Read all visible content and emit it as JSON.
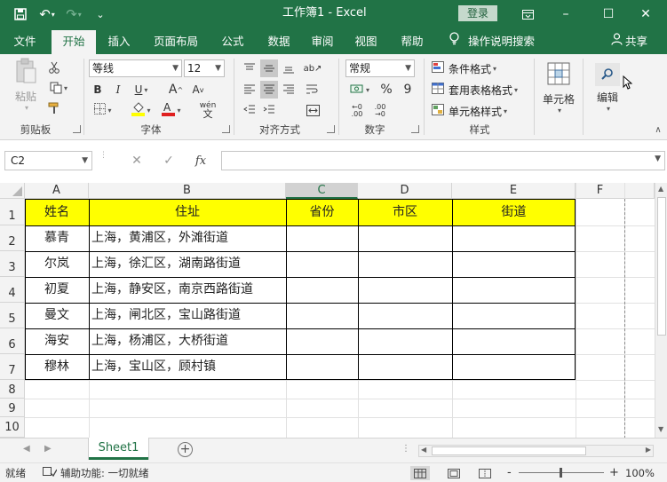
{
  "app": {
    "title": "工作簿1 - Excel",
    "login_label": "登录"
  },
  "qat": {
    "save_icon": "save-icon",
    "undo_icon": "undo-icon",
    "redo_icon": "redo-icon",
    "customize_icon": "chevron-down-icon"
  },
  "window": {
    "restore_icon": "ribbon-display-icon",
    "minimize": "–",
    "maximize": "☐",
    "close": "✕"
  },
  "menu": {
    "tabs": [
      "文件",
      "开始",
      "插入",
      "页面布局",
      "公式",
      "数据",
      "审阅",
      "视图",
      "帮助"
    ],
    "active_tab": "开始",
    "search_label": "操作说明搜索",
    "share_label": "共享"
  },
  "ribbon": {
    "clipboard": {
      "label": "剪贴板",
      "paste_label": "粘贴"
    },
    "font": {
      "label": "字体",
      "font_name": "等线",
      "font_size": "12",
      "bold": "B",
      "italic": "I",
      "underline": "U",
      "grow": "A",
      "shrink": "A",
      "phonetic": "wén"
    },
    "alignment": {
      "label": "对齐方式"
    },
    "number": {
      "label": "数字",
      "format": "常规",
      "percent": "%",
      "comma": "9"
    },
    "styles": {
      "label": "样式",
      "conditional": "条件格式",
      "table": "套用表格格式",
      "cell_styles": "单元格样式"
    },
    "cells": {
      "label": "单元格"
    },
    "editing": {
      "label": "编辑"
    },
    "accent": "#217346"
  },
  "formula_bar": {
    "name_box": "C2",
    "cancel": "✕",
    "enter": "✓",
    "fx": "fx",
    "formula": ""
  },
  "sheet": {
    "columns": [
      "A",
      "B",
      "C",
      "D",
      "E",
      "F"
    ],
    "selected_column": "C",
    "rows": [
      "1",
      "2",
      "3",
      "4",
      "5",
      "6",
      "7",
      "8",
      "9",
      "10"
    ],
    "header": [
      "姓名",
      "住址",
      "省份",
      "市区",
      "街道"
    ],
    "data": [
      [
        "慕青",
        "上海，黄浦区，外滩街道"
      ],
      [
        "尔岚",
        "上海，徐汇区，湖南路街道"
      ],
      [
        "初夏",
        "上海，静安区，南京西路街道"
      ],
      [
        "曼文",
        "上海，闸北区，宝山路街道"
      ],
      [
        "海安",
        "上海，杨浦区，大桥街道"
      ],
      [
        "穆林",
        "上海，宝山区，顾村镇"
      ]
    ],
    "header_fill": "#ffff00"
  },
  "sheet_tabs": {
    "tabs": [
      "Sheet1"
    ],
    "add_label": "+"
  },
  "status": {
    "ready": "就绪",
    "accessibility": "辅助功能: 一切就绪",
    "zoom_minus": "-",
    "zoom_plus": "+",
    "zoom": "100%"
  }
}
